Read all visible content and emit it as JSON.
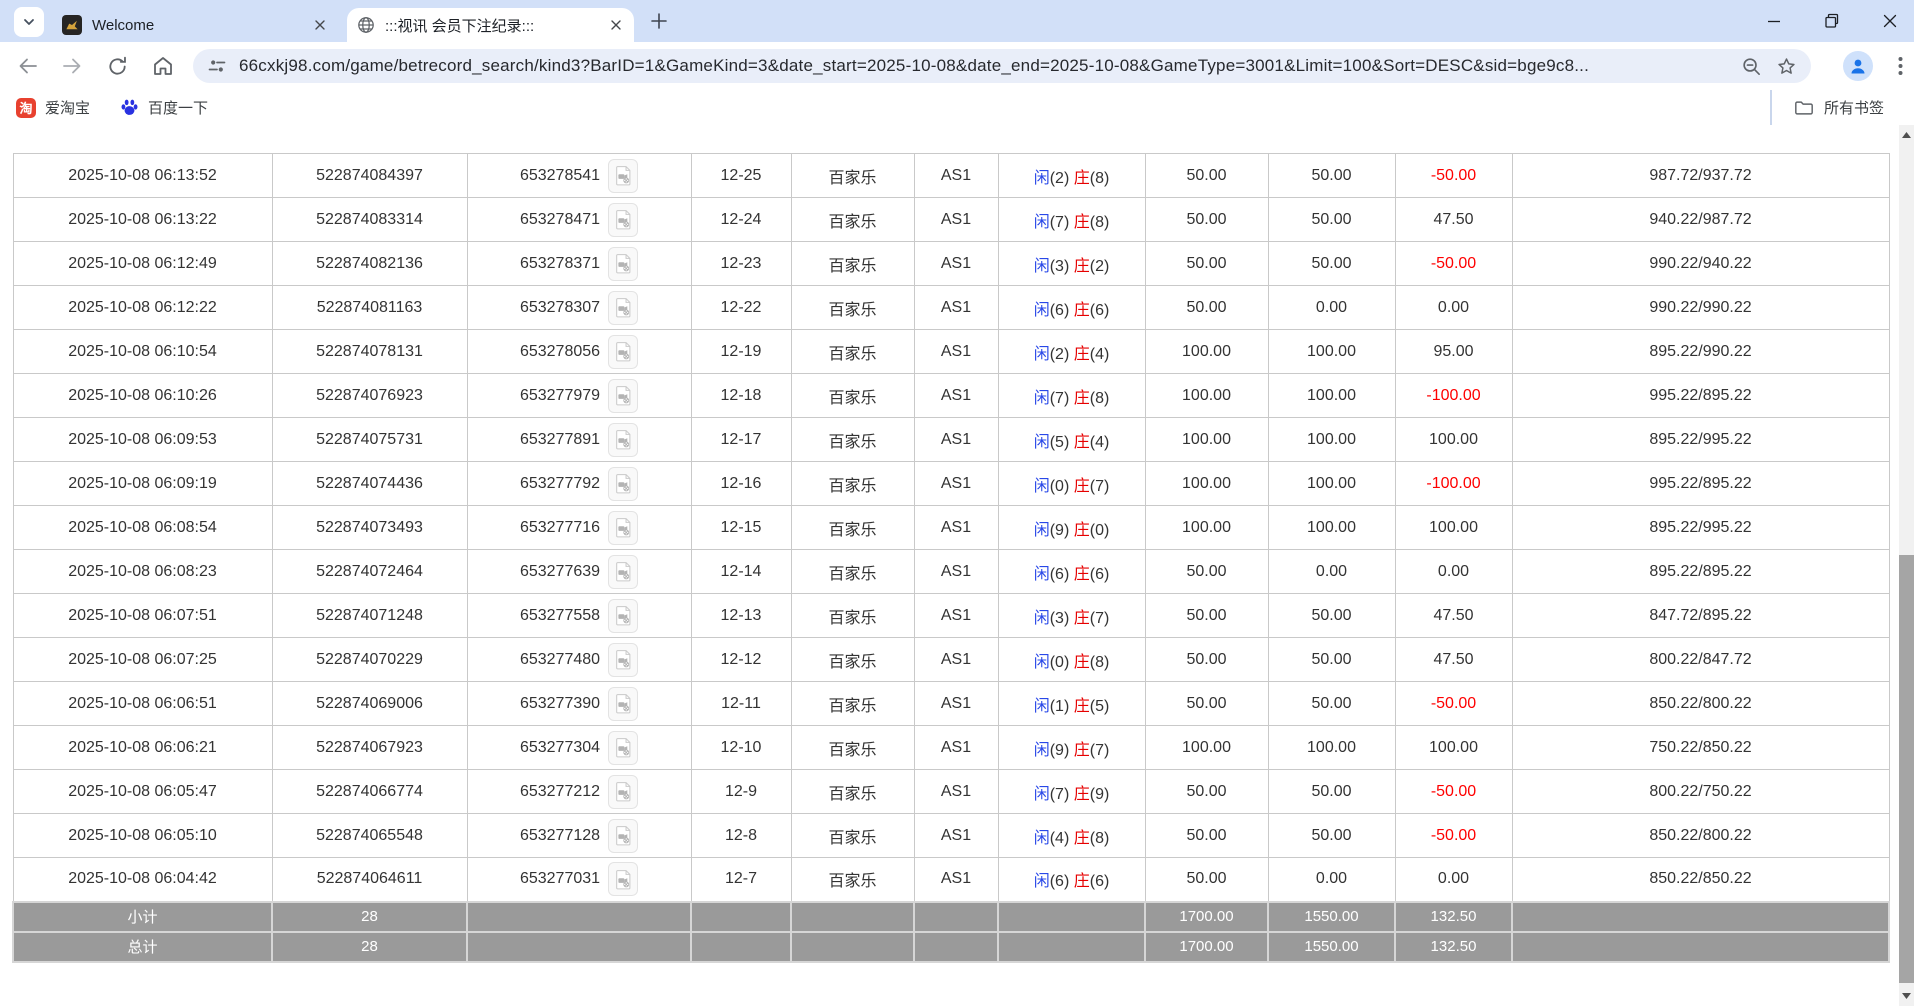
{
  "browser": {
    "tabs": [
      {
        "title": "Welcome"
      },
      {
        "title": ":::视讯 会员下注纪录:::"
      }
    ],
    "url": "66cxkj98.com/game/betrecord_search/kind3?BarID=1&GameKind=3&date_start=2025-10-08&date_end=2025-10-08&GameType=3001&Limit=100&Sort=DESC&sid=bge9c8...",
    "bookmarks": {
      "taobao_glyph": "淘",
      "items": [
        {
          "label": "爱淘宝"
        },
        {
          "label": "百度一下"
        }
      ],
      "all_bookmarks_label": "所有书签"
    }
  },
  "page": {
    "result_labels": {
      "player": "闲",
      "banker": "庄"
    },
    "rows": [
      {
        "time": "2025-10-08 06:13:52",
        "bet_id": "522874084397",
        "round": "653278541",
        "session": "12-25",
        "game": "百家乐",
        "account": "AS1",
        "player": "(2)",
        "banker": "(8)",
        "bet": "50.00",
        "valid": "50.00",
        "win": "-50.00",
        "balance": "987.72/937.72"
      },
      {
        "time": "2025-10-08 06:13:22",
        "bet_id": "522874083314",
        "round": "653278471",
        "session": "12-24",
        "game": "百家乐",
        "account": "AS1",
        "player": "(7)",
        "banker": "(8)",
        "bet": "50.00",
        "valid": "50.00",
        "win": "47.50",
        "balance": "940.22/987.72"
      },
      {
        "time": "2025-10-08 06:12:49",
        "bet_id": "522874082136",
        "round": "653278371",
        "session": "12-23",
        "game": "百家乐",
        "account": "AS1",
        "player": "(3)",
        "banker": "(2)",
        "bet": "50.00",
        "valid": "50.00",
        "win": "-50.00",
        "balance": "990.22/940.22"
      },
      {
        "time": "2025-10-08 06:12:22",
        "bet_id": "522874081163",
        "round": "653278307",
        "session": "12-22",
        "game": "百家乐",
        "account": "AS1",
        "player": "(6)",
        "banker": "(6)",
        "bet": "50.00",
        "valid": "0.00",
        "win": "0.00",
        "balance": "990.22/990.22"
      },
      {
        "time": "2025-10-08 06:10:54",
        "bet_id": "522874078131",
        "round": "653278056",
        "session": "12-19",
        "game": "百家乐",
        "account": "AS1",
        "player": "(2)",
        "banker": "(4)",
        "bet": "100.00",
        "valid": "100.00",
        "win": "95.00",
        "balance": "895.22/990.22"
      },
      {
        "time": "2025-10-08 06:10:26",
        "bet_id": "522874076923",
        "round": "653277979",
        "session": "12-18",
        "game": "百家乐",
        "account": "AS1",
        "player": "(7)",
        "banker": "(8)",
        "bet": "100.00",
        "valid": "100.00",
        "win": "-100.00",
        "balance": "995.22/895.22"
      },
      {
        "time": "2025-10-08 06:09:53",
        "bet_id": "522874075731",
        "round": "653277891",
        "session": "12-17",
        "game": "百家乐",
        "account": "AS1",
        "player": "(5)",
        "banker": "(4)",
        "bet": "100.00",
        "valid": "100.00",
        "win": "100.00",
        "balance": "895.22/995.22"
      },
      {
        "time": "2025-10-08 06:09:19",
        "bet_id": "522874074436",
        "round": "653277792",
        "session": "12-16",
        "game": "百家乐",
        "account": "AS1",
        "player": "(0)",
        "banker": "(7)",
        "bet": "100.00",
        "valid": "100.00",
        "win": "-100.00",
        "balance": "995.22/895.22"
      },
      {
        "time": "2025-10-08 06:08:54",
        "bet_id": "522874073493",
        "round": "653277716",
        "session": "12-15",
        "game": "百家乐",
        "account": "AS1",
        "player": "(9)",
        "banker": "(0)",
        "bet": "100.00",
        "valid": "100.00",
        "win": "100.00",
        "balance": "895.22/995.22"
      },
      {
        "time": "2025-10-08 06:08:23",
        "bet_id": "522874072464",
        "round": "653277639",
        "session": "12-14",
        "game": "百家乐",
        "account": "AS1",
        "player": "(6)",
        "banker": "(6)",
        "bet": "50.00",
        "valid": "0.00",
        "win": "0.00",
        "balance": "895.22/895.22"
      },
      {
        "time": "2025-10-08 06:07:51",
        "bet_id": "522874071248",
        "round": "653277558",
        "session": "12-13",
        "game": "百家乐",
        "account": "AS1",
        "player": "(3)",
        "banker": "(7)",
        "bet": "50.00",
        "valid": "50.00",
        "win": "47.50",
        "balance": "847.72/895.22"
      },
      {
        "time": "2025-10-08 06:07:25",
        "bet_id": "522874070229",
        "round": "653277480",
        "session": "12-12",
        "game": "百家乐",
        "account": "AS1",
        "player": "(0)",
        "banker": "(8)",
        "bet": "50.00",
        "valid": "50.00",
        "win": "47.50",
        "balance": "800.22/847.72"
      },
      {
        "time": "2025-10-08 06:06:51",
        "bet_id": "522874069006",
        "round": "653277390",
        "session": "12-11",
        "game": "百家乐",
        "account": "AS1",
        "player": "(1)",
        "banker": "(5)",
        "bet": "50.00",
        "valid": "50.00",
        "win": "-50.00",
        "balance": "850.22/800.22"
      },
      {
        "time": "2025-10-08 06:06:21",
        "bet_id": "522874067923",
        "round": "653277304",
        "session": "12-10",
        "game": "百家乐",
        "account": "AS1",
        "player": "(9)",
        "banker": "(7)",
        "bet": "100.00",
        "valid": "100.00",
        "win": "100.00",
        "balance": "750.22/850.22"
      },
      {
        "time": "2025-10-08 06:05:47",
        "bet_id": "522874066774",
        "round": "653277212",
        "session": "12-9",
        "game": "百家乐",
        "account": "AS1",
        "player": "(7)",
        "banker": "(9)",
        "bet": "50.00",
        "valid": "50.00",
        "win": "-50.00",
        "balance": "800.22/750.22"
      },
      {
        "time": "2025-10-08 06:05:10",
        "bet_id": "522874065548",
        "round": "653277128",
        "session": "12-8",
        "game": "百家乐",
        "account": "AS1",
        "player": "(4)",
        "banker": "(8)",
        "bet": "50.00",
        "valid": "50.00",
        "win": "-50.00",
        "balance": "850.22/800.22"
      },
      {
        "time": "2025-10-08 06:04:42",
        "bet_id": "522874064611",
        "round": "653277031",
        "session": "12-7",
        "game": "百家乐",
        "account": "AS1",
        "player": "(6)",
        "banker": "(6)",
        "bet": "50.00",
        "valid": "0.00",
        "win": "0.00",
        "balance": "850.22/850.22"
      }
    ],
    "footer": [
      {
        "label": "小计",
        "count": "28",
        "bet": "1700.00",
        "valid": "1550.00",
        "win": "132.50"
      },
      {
        "label": "总计",
        "count": "28",
        "bet": "1700.00",
        "valid": "1550.00",
        "win": "132.50"
      }
    ]
  },
  "colors": {
    "tabstrip_bg": "#d2e0f8",
    "bet_blue": "#2a6ae8",
    "player_blue": "#2948e8",
    "banker_red": "#e60000",
    "negative_red": "#ff0000",
    "footer_gray": "#9a9a9a",
    "profile_blue": "#1a73e8"
  }
}
